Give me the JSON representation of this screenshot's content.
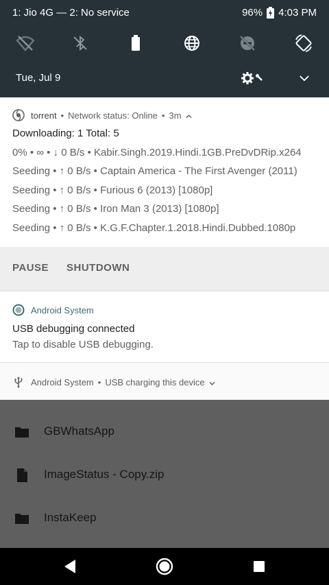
{
  "status_bar": {
    "carrier": "1: Jio 4G — 2: No service",
    "battery": "96%",
    "time": "4:03 PM"
  },
  "quick_settings": {
    "tiles": [
      {
        "icon": "wifi-off-icon"
      },
      {
        "icon": "bluetooth-off-icon"
      },
      {
        "icon": "battery-saver-icon"
      },
      {
        "icon": "globe-icon"
      },
      {
        "icon": "do-not-disturb-off-icon"
      },
      {
        "icon": "auto-rotate-icon"
      }
    ],
    "date": "Tue, Jul 9"
  },
  "torrent_notification": {
    "app": "torrent",
    "status": "Network status: Online",
    "age": "3m",
    "title": "Downloading: 1 Total: 5",
    "lines": [
      "0% • ∞ • ↓ 0 B/s • Kabir.Singh.2019.Hindi.1GB.PreDvDRip.x264",
      "Seeding • ↑ 0 B/s • Captain America - The First Avenger (2011)",
      "Seeding • ↑ 0 B/s • Furious 6 (2013) [1080p]",
      "Seeding • ↑ 0 B/s • Iron Man 3 (2013) [1080p]",
      "Seeding • ↑ 0 B/s • K.G.F.Chapter.1.2018.Hindi.Dubbed.1080p"
    ],
    "actions": {
      "pause": "PAUSE",
      "shutdown": "SHUTDOWN"
    }
  },
  "usb_debug_notification": {
    "app": "Android System",
    "title": "USB debugging connected",
    "text": "Tap to disable USB debugging."
  },
  "usb_charging_notification": {
    "app": "Android System",
    "text": "USB charging this device"
  },
  "files": [
    {
      "name": "GBWhatsApp",
      "type": "folder"
    },
    {
      "name": "ImageStatus - Copy.zip",
      "type": "file"
    },
    {
      "name": "InstaKeep",
      "type": "folder"
    }
  ],
  "colors": {
    "shade_bg": "#263238",
    "accent": "#3c6e71",
    "dim_bg": "#5f5f5f"
  }
}
